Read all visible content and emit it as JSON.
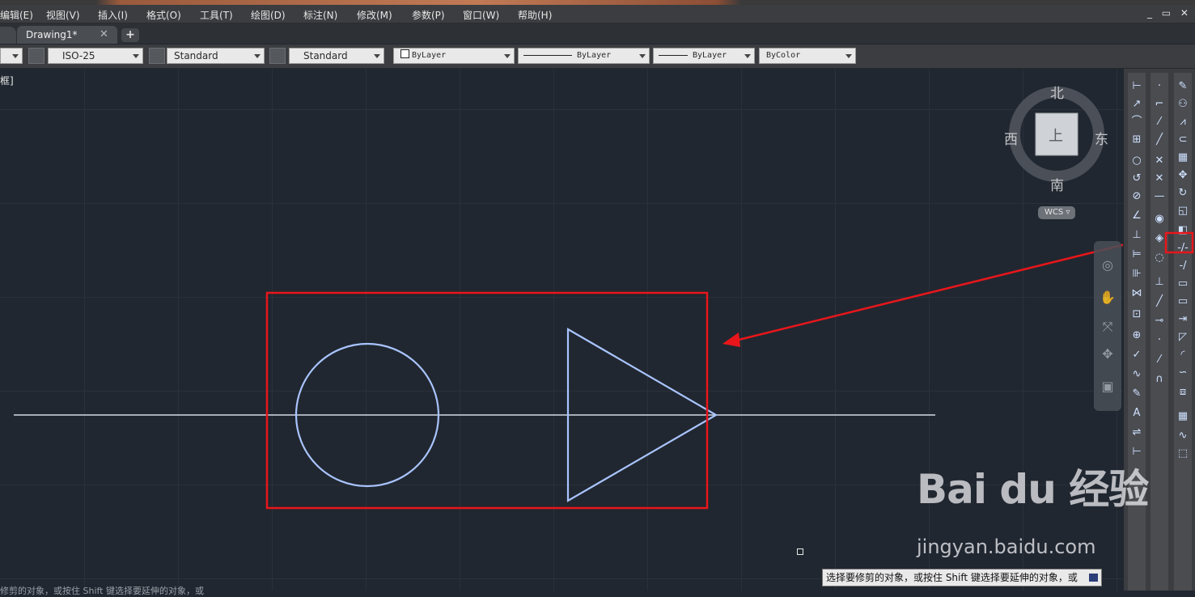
{
  "menu": {
    "items": [
      "编辑(E)",
      "视图(V)",
      "插入(I)",
      "格式(O)",
      "工具(T)",
      "绘图(D)",
      "标注(N)",
      "修改(M)",
      "参数(P)",
      "窗口(W)",
      "帮助(H)"
    ],
    "window_controls": "_ ▭ ✕"
  },
  "tabs": {
    "active": "Drawing1*",
    "close": "✕",
    "add": "+"
  },
  "toolbar": {
    "dim_style": "ISO-25",
    "text_style": "Standard",
    "table_style": "Standard",
    "layer_color": "ByLayer",
    "linetype": "ByLayer",
    "lineweight": "ByLayer",
    "plot_style": "ByColor"
  },
  "viewport": {
    "label": "框]"
  },
  "viewcube": {
    "north": "北",
    "south": "南",
    "east": "东",
    "west": "西",
    "top_face": "上",
    "wcs": "WCS ▿"
  },
  "command": {
    "tooltip": "选择要修剪的对象，或按住 Shift 键选择要延伸的对象，或",
    "history": "修剪的对象，或按住 Shift 键选择要延伸的对象，或"
  },
  "watermark": {
    "brand": "Bai  du 经验",
    "url": "jingyan.baidu.com"
  },
  "colors": {
    "canvas": "#212730",
    "geometry": "#a9c4ff",
    "annotation": "#e8161b",
    "axis_line": "#d6dbe4"
  }
}
